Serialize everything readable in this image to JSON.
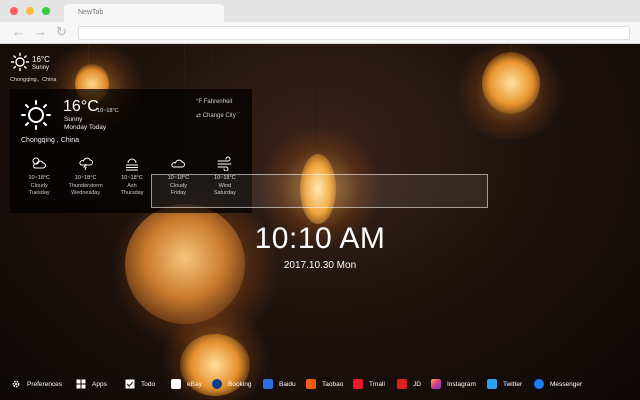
{
  "browser": {
    "tab_title": "NewTab"
  },
  "mini_weather": {
    "temp": "16°C",
    "condition": "Sunny",
    "location": "Chongqing，China"
  },
  "weather_panel": {
    "temp": "16°C",
    "range": "10~18°C",
    "condition": "Sunny",
    "day": "Monday Today",
    "location": "Chongqing , China",
    "unit_link": "°F  Fahrenheit",
    "change_city_link": "⇄  Change City",
    "forecast": [
      {
        "icon": "cloudy-icon",
        "range": "10~18°C",
        "condition": "Cloudy",
        "day": "Tuesday"
      },
      {
        "icon": "thunderstorm-icon",
        "range": "10~18°C",
        "condition": "Thunderstorm",
        "day": "Wednesday"
      },
      {
        "icon": "ash-icon",
        "range": "10~18°C",
        "condition": "Ash",
        "day": "Thursday"
      },
      {
        "icon": "cloud-icon",
        "range": "10~18°C",
        "condition": "Cloudy",
        "day": "Friday"
      },
      {
        "icon": "wind-icon",
        "range": "10~18°C",
        "condition": "Wind",
        "day": "Saturday"
      }
    ]
  },
  "clock": {
    "time": "10:10 AM",
    "date": "2017.10.30 Mon"
  },
  "bottom_bar": {
    "preferences": "Preferences",
    "apps": "Apps",
    "todo": "Todo",
    "links": [
      {
        "name": "ebay",
        "label": "eBay",
        "color": "#ffffff"
      },
      {
        "name": "booking",
        "label": "Booking",
        "color": "#0c3b8c"
      },
      {
        "name": "baidu",
        "label": "Baidu",
        "color": "#2d6fe0"
      },
      {
        "name": "taobao",
        "label": "Taobao",
        "color": "#f25a16"
      },
      {
        "name": "tmall",
        "label": "Tmall",
        "color": "#e3182d"
      },
      {
        "name": "jd",
        "label": "JD",
        "color": "#e01f1f"
      },
      {
        "name": "instagram",
        "label": "Instagram",
        "color": "#d63a8a"
      },
      {
        "name": "twitter",
        "label": "Twitter",
        "color": "#2aa3ef"
      },
      {
        "name": "messenger",
        "label": "Messenger",
        "color": "#1b7bf3"
      }
    ]
  }
}
